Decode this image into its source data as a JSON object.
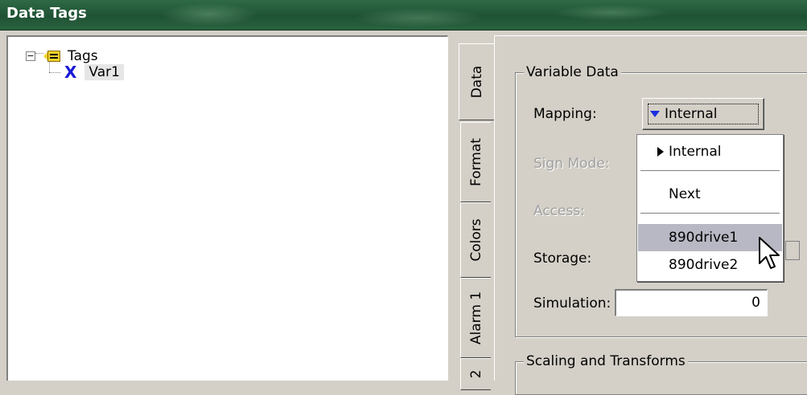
{
  "window": {
    "title": "Data Tags"
  },
  "tree": {
    "root": {
      "label": "Tags",
      "expander": "−"
    },
    "children": [
      {
        "label": "Var1"
      }
    ]
  },
  "tabs": [
    "Data",
    "Format",
    "Colors",
    "Alarm 1",
    "2"
  ],
  "variable_data": {
    "title": "Variable Data",
    "mapping_label": "Mapping:",
    "mapping_value": "Internal",
    "sign_mode_label": "Sign Mode:",
    "access_label": "Access:",
    "storage_label": "Storage:",
    "simulation_label": "Simulation:",
    "simulation_value": "0"
  },
  "mapping_menu": {
    "items": [
      "Internal",
      "Next",
      "890drive1",
      "890drive2"
    ],
    "selected": "Internal",
    "highlighted": "890drive1"
  },
  "scaling": {
    "title": "Scaling and Transforms"
  },
  "colors": {
    "titlebar": "#1f5234",
    "selection": "#b8b8c4",
    "dropdown_arrow": "#1a2ee0"
  }
}
